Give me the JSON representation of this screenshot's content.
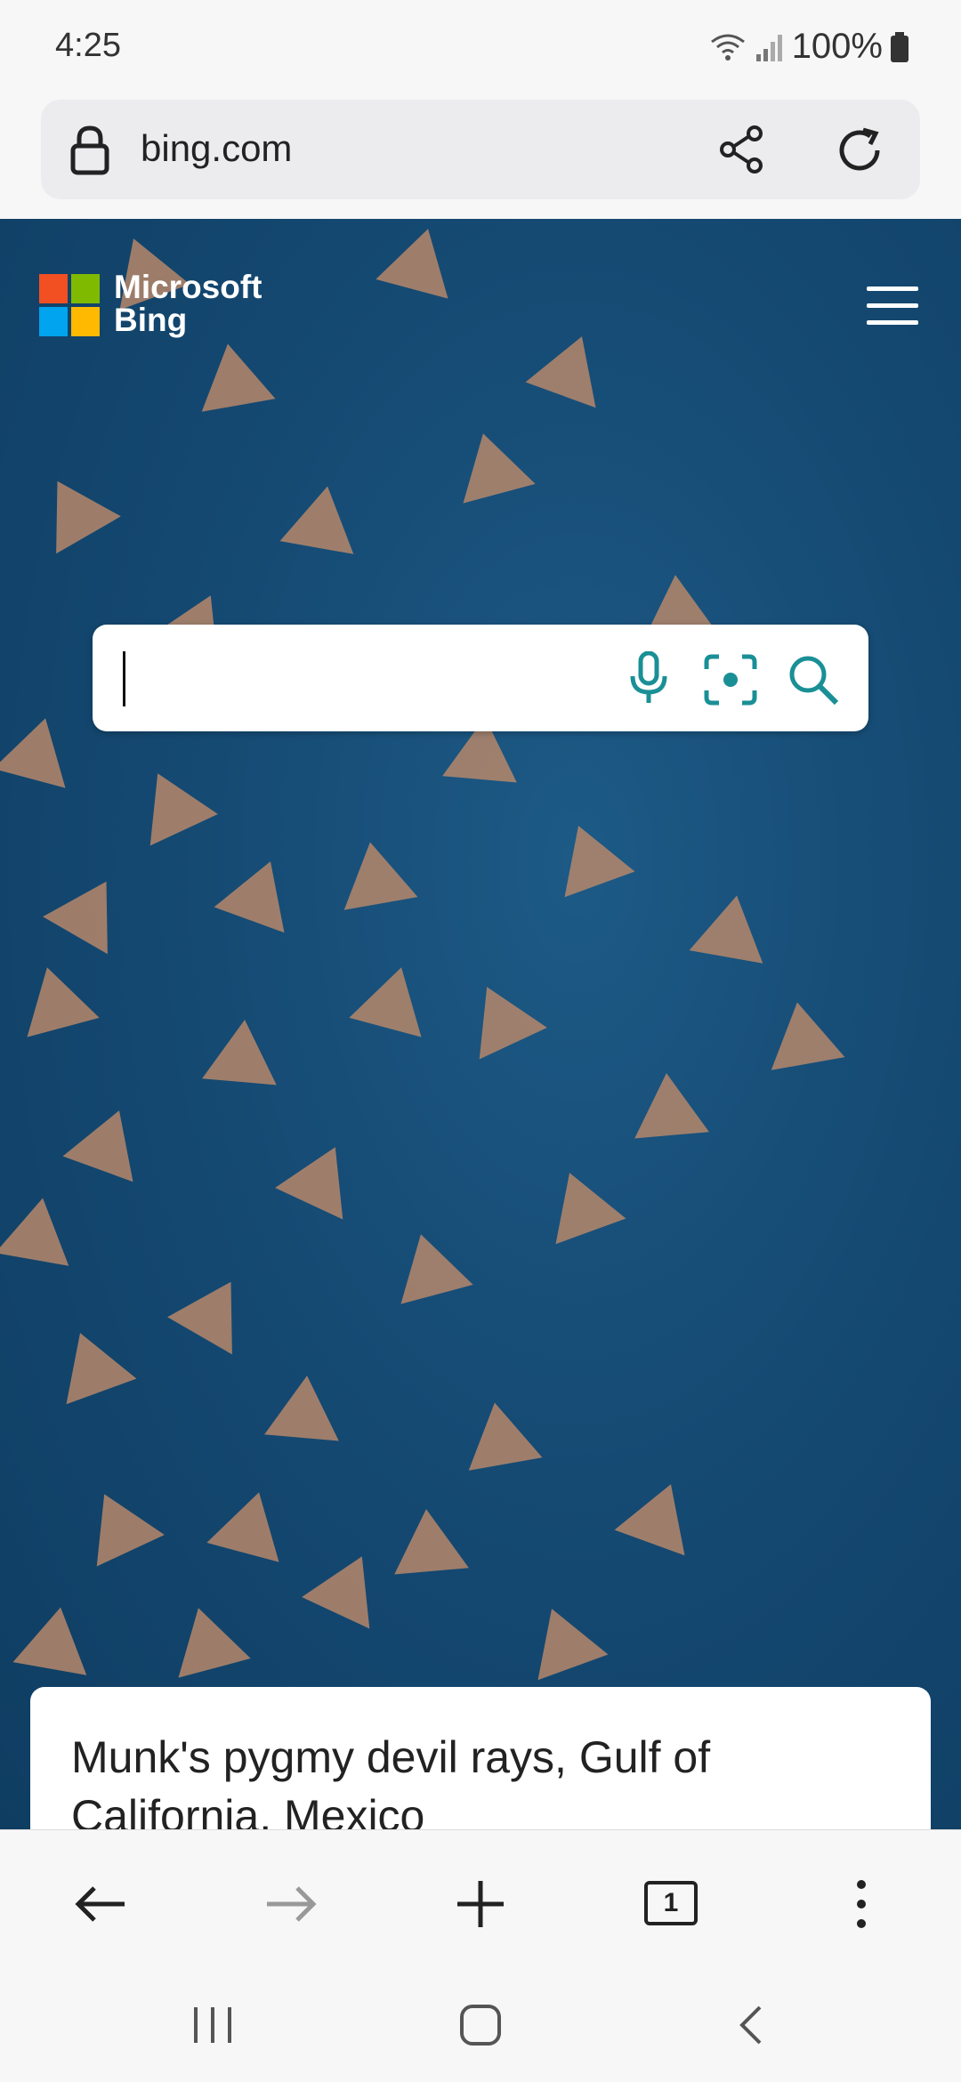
{
  "status_bar": {
    "time": "4:25",
    "battery": "100%"
  },
  "browser": {
    "url": "bing.com"
  },
  "bing": {
    "brand_line1": "Microsoft",
    "brand_line2": "Bing",
    "search_placeholder": ""
  },
  "caption": {
    "text": "Munk's pygmy devil rays, Gulf of California, Mexico"
  },
  "toolbar": {
    "tab_count": "1"
  },
  "icons": {
    "url_bar": [
      "lock-icon",
      "share-icon",
      "refresh-icon"
    ],
    "search": [
      "microphone-icon",
      "visual-search-icon",
      "search-icon"
    ],
    "toolbar": [
      "back-arrow-icon",
      "forward-arrow-icon",
      "plus-icon",
      "tabs-icon",
      "more-icon"
    ],
    "system_nav": [
      "recents-icon",
      "home-icon",
      "back-icon"
    ]
  },
  "colors": {
    "accent": "#1a8f96",
    "ocean": "#154a73",
    "logo_red": "#f25022",
    "logo_green": "#7fba00",
    "logo_blue": "#00a4ef",
    "logo_yellow": "#ffb900"
  }
}
